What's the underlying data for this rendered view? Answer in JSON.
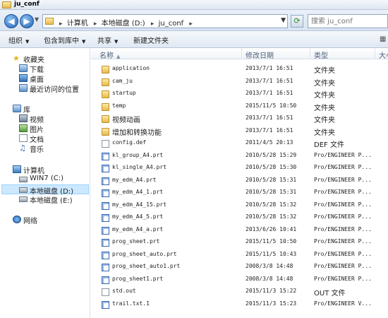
{
  "window": {
    "title": "ju_conf"
  },
  "address": {
    "crumbs": [
      "计算机",
      "本地磁盘 (D:)",
      "ju_conf"
    ],
    "search_placeholder": "搜索 ju_conf"
  },
  "toolbar": {
    "organize": "组织",
    "include_library": "包含到库中",
    "share": "共享",
    "new_folder": "新建文件夹"
  },
  "nav": {
    "favorites": "收藏夹",
    "downloads": "下载",
    "desktop": "桌面",
    "recent": "最近访问的位置",
    "libraries": "库",
    "videos": "视频",
    "pictures": "图片",
    "documents": "文档",
    "music": "音乐",
    "computer": "计算机",
    "drive_c": "WIN7 (C:)",
    "drive_d": "本地磁盘 (D:)",
    "drive_e": "本地磁盘 (E:)",
    "network": "网络"
  },
  "columns": {
    "name": "名称",
    "date": "修改日期",
    "type": "类型",
    "size": "大小"
  },
  "files": [
    {
      "name": "application",
      "date": "2013/7/1 16:51",
      "type": "文件夹",
      "kind": "folder"
    },
    {
      "name": "cam_ju",
      "date": "2013/7/1 16:51",
      "type": "文件夹",
      "kind": "folder"
    },
    {
      "name": "startup",
      "date": "2013/7/1 16:51",
      "type": "文件夹",
      "kind": "folder"
    },
    {
      "name": "temp",
      "date": "2015/11/5 10:50",
      "type": "文件夹",
      "kind": "folder"
    },
    {
      "name": "视频动画",
      "date": "2013/7/1 16:51",
      "type": "文件夹",
      "kind": "folder"
    },
    {
      "name": "增加和转换功能",
      "date": "2013/7/1 16:51",
      "type": "文件夹",
      "kind": "folder"
    },
    {
      "name": "config.def",
      "date": "2011/4/5 20:13",
      "type": "DEF 文件",
      "kind": "txt"
    },
    {
      "name": "kl_group_A4.prt",
      "date": "2010/5/28 15:29",
      "type": "Pro/ENGINEER P...",
      "kind": "prt"
    },
    {
      "name": "kl_single_A4.prt",
      "date": "2010/5/28 15:30",
      "type": "Pro/ENGINEER P...",
      "kind": "prt"
    },
    {
      "name": "my_edm_A4.prt",
      "date": "2010/5/28 15:31",
      "type": "Pro/ENGINEER P...",
      "kind": "prt"
    },
    {
      "name": "my_edm_A4_1.prt",
      "date": "2010/5/28 15:31",
      "type": "Pro/ENGINEER P...",
      "kind": "prt"
    },
    {
      "name": "my_edm_A4_15.prt",
      "date": "2010/5/28 15:32",
      "type": "Pro/ENGINEER P...",
      "kind": "prt"
    },
    {
      "name": "my_edm_A4_5.prt",
      "date": "2010/5/28 15:32",
      "type": "Pro/ENGINEER P...",
      "kind": "prt"
    },
    {
      "name": "my_edm_A4_a.prt",
      "date": "2013/6/26 10:41",
      "type": "Pro/ENGINEER P...",
      "kind": "prt"
    },
    {
      "name": "prog_sheet.prt",
      "date": "2015/11/5 10:50",
      "type": "Pro/ENGINEER P...",
      "kind": "prt"
    },
    {
      "name": "prog_sheet_auto.prt",
      "date": "2015/11/5 10:43",
      "type": "Pro/ENGINEER P...",
      "kind": "prt"
    },
    {
      "name": "prog_sheet_auto1.prt",
      "date": "2008/3/8 14:48",
      "type": "Pro/ENGINEER P...",
      "kind": "prt"
    },
    {
      "name": "prog_sheet1.prt",
      "date": "2008/3/8 14:48",
      "type": "Pro/ENGINEER P...",
      "kind": "prt"
    },
    {
      "name": "std.out",
      "date": "2015/11/3 15:22",
      "type": "OUT 文件",
      "kind": "txt"
    },
    {
      "name": "trail.txt.1",
      "date": "2015/11/3 15:23",
      "type": "Pro/ENGINEER V...",
      "kind": "prt"
    }
  ]
}
